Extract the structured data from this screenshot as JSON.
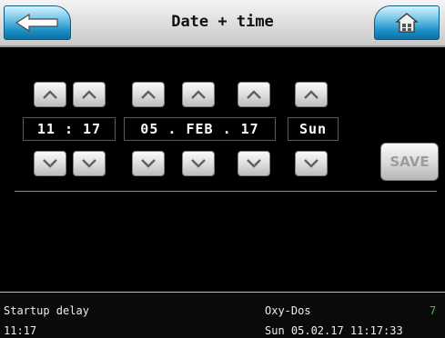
{
  "header": {
    "title": "Date + time",
    "back_icon": "back-arrow-icon",
    "home_icon": "home-icon",
    "accent": "#1a8fc5"
  },
  "datetime": {
    "time": "11 : 17",
    "date": "05 . FEB . 17",
    "weekday": "Sun",
    "up_icon": "chevron-up-icon",
    "down_icon": "chevron-down-icon"
  },
  "actions": {
    "save_label": "SAVE"
  },
  "status": {
    "left_top": "Startup delay",
    "left_bottom": "11:17",
    "right_top": "Oxy-Dos",
    "right_top_indicator": "7",
    "indicator_color": "#35c535",
    "right_bottom": "Sun 05.02.17 11:17:33"
  }
}
